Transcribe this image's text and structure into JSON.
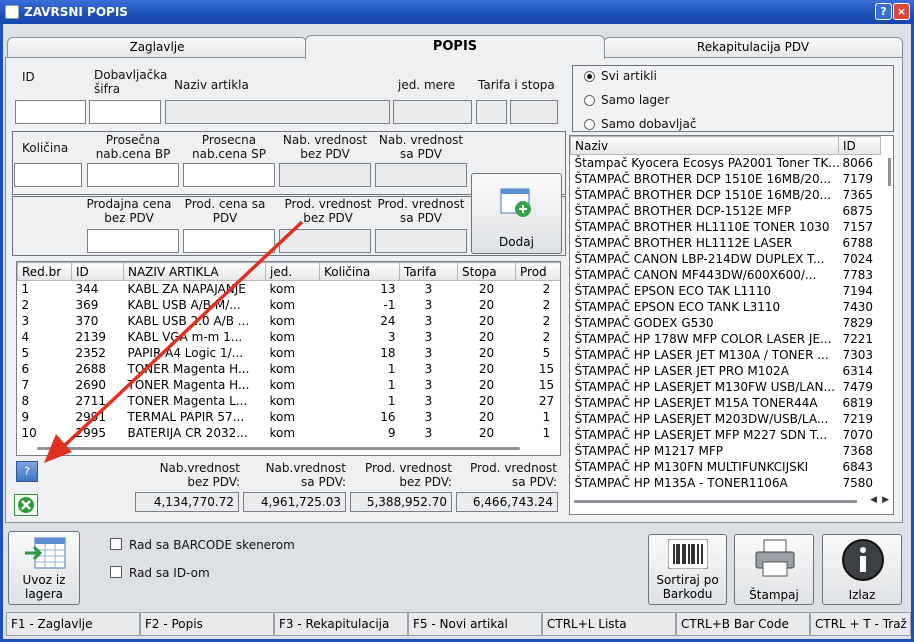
{
  "window": {
    "title": "ZAVRSNI POPIS",
    "help": "?",
    "close": "×"
  },
  "tabs": [
    "Zaglavlje",
    "POPIS",
    "Rekapitulacija PDV"
  ],
  "fields": {
    "id": "ID",
    "dob_sifra": "Dobavljačka\nšifra",
    "naziv": "Naziv artikla",
    "jed_mere": "jed. mere",
    "tarifa_stopa": "Tarifa i stopa",
    "kolicina": "Količina",
    "prosecna_bp": "Prosečna\nnab.cena BP",
    "prosecna_sp": "Prosecna\nnab.cena SP",
    "nab_bez": "Nab. vrednost\nbez PDV",
    "nab_sa": "Nab. vrednost\nsa PDV",
    "prod_cena_bez": "Prodajna cena\nbez PDV",
    "prod_cena_sa": "Prod. cena sa\nPDV",
    "prod_vred_bez": "Prod. vrednost\nbez PDV",
    "prod_vred_sa": "Prod. vrednost\nsa PDV"
  },
  "dodaj": "Dodaj",
  "radio": {
    "options": [
      "Svi artikli",
      "Samo lager",
      "Samo dobavljač"
    ],
    "selected": 0
  },
  "table": {
    "columns": [
      "Red.br",
      "ID",
      "NAZIV ARTIKLA",
      "jed.",
      "Količina",
      "Tarifa",
      "Stopa",
      "Prod"
    ],
    "rows": [
      [
        "1",
        "344",
        "KABL ZA NAPAJANJE",
        "kom",
        "13",
        "3",
        "20",
        "2"
      ],
      [
        "2",
        "369",
        "KABL USB A/B M/...",
        "kom",
        "-1",
        "3",
        "20",
        "2"
      ],
      [
        "3",
        "370",
        "KABL USB 2.0 A/B ...",
        "kom",
        "24",
        "3",
        "20",
        "2"
      ],
      [
        "4",
        "2139",
        "KABL VGA m-m 1...",
        "kom",
        "3",
        "3",
        "20",
        "2"
      ],
      [
        "5",
        "2352",
        "PAPIR A4 Logic 1/...",
        "kom",
        "18",
        "3",
        "20",
        "5"
      ],
      [
        "6",
        "2688",
        "TONER Magenta H...",
        "kom",
        "1",
        "3",
        "20",
        "15"
      ],
      [
        "7",
        "2690",
        "TONER Magenta H...",
        "kom",
        "1",
        "3",
        "20",
        "15"
      ],
      [
        "8",
        "2711",
        "TONER Magenta L...",
        "kom",
        "1",
        "3",
        "20",
        "27"
      ],
      [
        "9",
        "2991",
        "TERMAL PAPIR 57...",
        "kom",
        "16",
        "3",
        "20",
        "1"
      ],
      [
        "10",
        "2995",
        "BATERIJA CR 2032...",
        "kom",
        "9",
        "3",
        "20",
        "1"
      ]
    ]
  },
  "totals": {
    "labels": [
      "Nab.vrednost\nbez PDV:",
      "Nab.vrednost\nsa PDV:",
      "Prod. vrednost\nbez PDV:",
      "Prod. vrednost\nsa PDV:"
    ],
    "values": [
      "4,134,770.72",
      "4,961,725.03",
      "5,388,952.70",
      "6,466,743.24"
    ]
  },
  "small_help": "?",
  "list": {
    "columns": [
      "Naziv",
      "ID"
    ],
    "rows": [
      [
        "Štampač Kyocera Ecosys PA2001 Toner TK...",
        "8066"
      ],
      [
        "ŠTAMPAČ BROTHER DCP 1510E 16MB/20...",
        "7179"
      ],
      [
        "ŠTAMPAČ BROTHER DCP 1510E 16MB/20...",
        "7365"
      ],
      [
        "ŠTAMPAČ BROTHER DCP-1512E MFP",
        "6875"
      ],
      [
        "ŠTAMPAČ BROTHER HL1110E TONER 1030",
        "7157"
      ],
      [
        "ŠTAMPAČ BROTHER HL1112E LASER",
        "6788"
      ],
      [
        "ŠTAMPAČ CANON LBP-214DW DUPLEX T...",
        "7024"
      ],
      [
        "ŠTAMPAČ CANON MF443DW/600X600/...",
        "7783"
      ],
      [
        "ŠTAMPAČ EPSON ECO TAK L1110",
        "7194"
      ],
      [
        "ŠTAMPAČ EPSON ECO TANK L3110",
        "7430"
      ],
      [
        "ŠTAMPAČ GODEX G530",
        "7829"
      ],
      [
        "ŠTAMPAČ HP 178W MFP COLOR LASER JE...",
        "7221"
      ],
      [
        "ŠTAMPAČ HP LASER JET M130A / TONER ...",
        "7303"
      ],
      [
        "ŠTAMPAČ HP LASER JET PRO M102A",
        "6314"
      ],
      [
        "ŠTAMPAČ HP LASERJET M130FW USB/LAN...",
        "7479"
      ],
      [
        "ŠTAMPAČ HP LASERJET M15A  TONER44A",
        "6819"
      ],
      [
        "ŠTAMPAČ HP LASERJET M203DW/USB/LA...",
        "7219"
      ],
      [
        "ŠTAMPAČ HP LASERJET MFP M227 SDN T...",
        "7070"
      ],
      [
        "ŠTAMPAČ HP M1217 MFP",
        "7368"
      ],
      [
        "ŠTAMPAČ HP M130FN MULTIFUNKCIJSKI",
        "6843"
      ],
      [
        "ŠTAMPAČ HP M135A - TONER1106A",
        "7580"
      ]
    ]
  },
  "checkboxes": [
    "Rad sa BARCODE skenerom",
    "Rad sa ID-om"
  ],
  "buttons": {
    "uvoz": "Uvoz iz\nlagera",
    "sortiraj": "Sortiraj po\nBarkodu",
    "stampaj": "Štampaj",
    "izlaz": "Izlaz"
  },
  "statusbar": [
    "F1 - Zaglavlje",
    "F2 - Popis",
    "F3 - Rekapitulacija",
    "F5 - Novi artikal",
    "CTRL+L Lista",
    "CTRL+B Bar Code",
    "CTRL + T - Traž"
  ],
  "colors": {
    "title": "#1c4fb8",
    "arrow": "#e03020"
  }
}
